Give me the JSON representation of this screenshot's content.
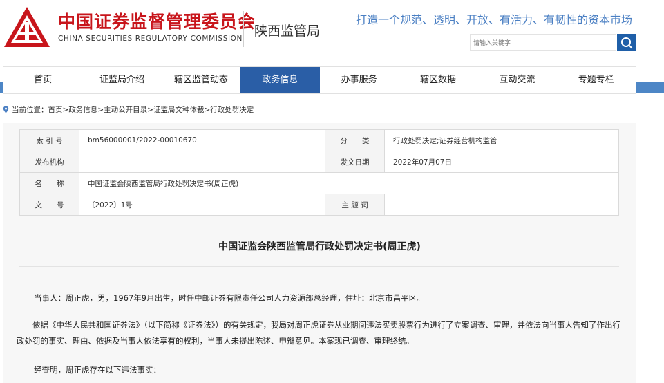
{
  "header": {
    "org_cn": "中国证券监督管理委员会",
    "org_en": "CHINA SECURITIES REGULATORY COMMISSION",
    "bureau": "陕西监管局",
    "slogan": "打造一个规范、透明、开放、有活力、有韧性的资本市场",
    "search_placeholder": "请输入关键字",
    "logo_icon": "csrc-logo-icon",
    "brand_color": "#c8151b",
    "accent_color": "#2a5ea6"
  },
  "nav": {
    "items": [
      {
        "label": "首页"
      },
      {
        "label": "证监局介绍"
      },
      {
        "label": "辖区监管动态"
      },
      {
        "label": "政务信息"
      },
      {
        "label": "办事服务"
      },
      {
        "label": "辖区数据"
      },
      {
        "label": "互动交流"
      },
      {
        "label": "专题专栏"
      }
    ],
    "active_index": 3
  },
  "breadcrumb": {
    "prefix": "当前位置：",
    "items": [
      "首页",
      "政务信息",
      "主动公开目录",
      "证监局文种体裁",
      "行政处罚决定"
    ],
    "separator": ">"
  },
  "meta": {
    "index_label": "索 引 号",
    "index_value": "bm56000001/2022-00010670",
    "category_label": "分　　类",
    "category_value": "行政处罚决定;证券经营机构监管",
    "publisher_label": "发布机构",
    "publisher_value": "",
    "date_label": "发文日期",
    "date_value": "2022年07月07日",
    "name_label": "名　　称",
    "name_value": "中国证监会陕西监管局行政处罚决定书(周正虎)",
    "docno_label": "文　　号",
    "docno_value": "〔2022〕1号",
    "keywords_label": "主 题 词",
    "keywords_value": ""
  },
  "document": {
    "title": "中国证监会陕西监管局行政处罚决定书(周正虎)",
    "paragraphs": [
      "当事人：周正虎，男，1967年9月出生，时任中邮证券有限责任公司人力资源部总经理，住址：北京市昌平区。",
      "依据《中华人民共和国证券法》（以下简称《证券法》）的有关规定，我局对周正虎证券从业期间违法买卖股票行为进行了立案调查、审理，并依法向当事人告知了作出行政处罚的事实、理由、依据及当事人依法享有的权利，当事人未提出陈述、申辩意见。本案现已调查、审理终结。",
      "经查明，周正虎存在以下违法事实："
    ]
  }
}
